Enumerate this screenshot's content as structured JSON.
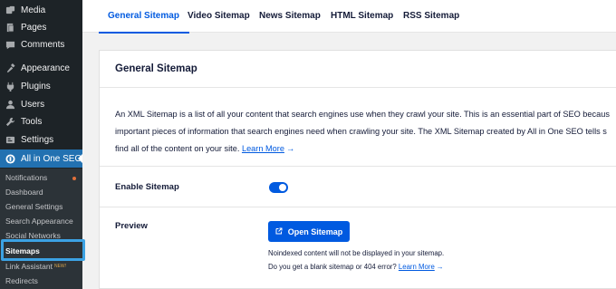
{
  "sidebar": {
    "items": [
      {
        "label": "Media",
        "icon": "media-icon"
      },
      {
        "label": "Pages",
        "icon": "pages-icon"
      },
      {
        "label": "Comments",
        "icon": "comments-icon"
      },
      {
        "label": "Appearance",
        "icon": "appearance-icon"
      },
      {
        "label": "Plugins",
        "icon": "plugins-icon"
      },
      {
        "label": "Users",
        "icon": "users-icon"
      },
      {
        "label": "Tools",
        "icon": "tools-icon"
      },
      {
        "label": "Settings",
        "icon": "settings-icon"
      },
      {
        "label": "All in One SEO",
        "icon": "aioseo-icon"
      }
    ],
    "submenu": [
      {
        "label": "Notifications"
      },
      {
        "label": "Dashboard"
      },
      {
        "label": "General Settings"
      },
      {
        "label": "Search Appearance"
      },
      {
        "label": "Social Networks"
      },
      {
        "label": "Sitemaps"
      },
      {
        "label": "Link Assistant",
        "badge": "NEW!"
      },
      {
        "label": "Redirects"
      }
    ]
  },
  "tabs": [
    {
      "label": "General Sitemap"
    },
    {
      "label": "Video Sitemap"
    },
    {
      "label": "News Sitemap"
    },
    {
      "label": "HTML Sitemap"
    },
    {
      "label": "RSS Sitemap"
    }
  ],
  "card": {
    "title": "General Sitemap",
    "description_lines": [
      "An XML Sitemap is a list of all your content that search engines use when they crawl your site. This is an essential part of SEO becaus",
      "important pieces of information that search engines need when crawling your site. The XML Sitemap created by All in One SEO tells s",
      "find all of the content on your site."
    ],
    "learn_more": "Learn More",
    "arrow": "→",
    "enable_label": "Enable Sitemap",
    "enable_value": true,
    "preview_label": "Preview",
    "open_button": "Open Sitemap",
    "note1": "Noindexed content will not be displayed in your sitemap.",
    "note2": "Do you get a blank sitemap or 404 error?"
  },
  "colors": {
    "accent": "#005ae0",
    "sidebar_bg": "#1d2327",
    "active_menu": "#2271b1",
    "highlight": "#3ca2e3"
  }
}
